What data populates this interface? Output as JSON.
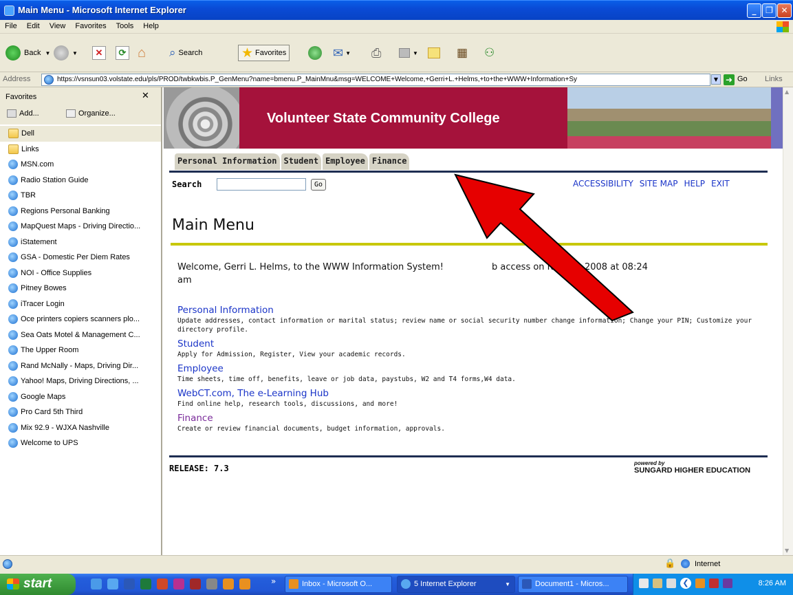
{
  "window": {
    "title": "Main Menu - Microsoft Internet Explorer"
  },
  "menubar": [
    "File",
    "Edit",
    "View",
    "Favorites",
    "Tools",
    "Help"
  ],
  "toolbar": {
    "back": "Back",
    "search": "Search",
    "favorites": "Favorites"
  },
  "address": {
    "label": "Address",
    "url": "https://vsnsun03.volstate.edu/pls/PROD/twbkwbis.P_GenMenu?name=bmenu.P_MainMnu&msg=WELCOME+Welcome,+Gerri+L.+Helms,+to+the+WWW+Information+Sy",
    "go": "Go",
    "links": "Links"
  },
  "favorites": {
    "title": "Favorites",
    "add": "Add...",
    "organize": "Organize...",
    "items": [
      "Dell",
      "Links",
      "MSN.com",
      "Radio Station Guide",
      "TBR",
      "Regions  Personal Banking",
      "MapQuest Maps - Driving Directio...",
      "iStatement",
      "GSA - Domestic Per Diem Rates",
      "NOI - Office Supplies",
      "Pitney Bowes",
      "iTracer Login",
      "Oce printers copiers scanners plo...",
      "Sea Oats Motel & Management C...",
      "The Upper Room",
      "Rand McNally - Maps, Driving Dir...",
      "Yahoo! Maps, Driving Directions, ...",
      "Google Maps",
      "Pro Card 5th Third",
      "Mix 92.9 - WJXA Nashville",
      "Welcome to UPS"
    ]
  },
  "page": {
    "college": "Volunteer State Community College",
    "tabs": [
      "Personal Information",
      "Student",
      "Employee",
      "Finance"
    ],
    "search_label": "Search",
    "go": "Go",
    "toplinks": [
      "ACCESSIBILITY",
      "SITE MAP",
      "HELP",
      "EXIT"
    ],
    "title": "Main Menu",
    "welcome_left": "Welcome, Gerri L. Helms, to the WWW Information System!",
    "welcome_right": "b access on Nov 04, 2008 at 08:24",
    "welcome_end": "am",
    "menu": [
      {
        "label": "Personal Information",
        "desc": "Update addresses, contact information or marital status; review name or social security number change information; Change your PIN; Customize your directory profile."
      },
      {
        "label": "Student",
        "desc": "Apply for Admission, Register, View your academic records."
      },
      {
        "label": "Employee",
        "desc": "Time sheets, time off, benefits, leave or job data, paystubs, W2 and T4 forms,W4 data."
      },
      {
        "label": "WebCT.com, The e-Learning Hub",
        "desc": "Find online help, research tools, discussions, and more!"
      },
      {
        "label": "Finance",
        "desc": "Create or review financial documents, budget information, approvals."
      }
    ],
    "release": "RELEASE: 7.3",
    "powered_by": "powered by",
    "sungard": "SUNGARD",
    "higher_ed": " HIGHER EDUCATION"
  },
  "status": {
    "zone": "Internet"
  },
  "taskbar": {
    "start": "start",
    "tasks": [
      "Inbox - Microsoft O...",
      "5 Internet Explorer",
      "Document1 - Micros..."
    ],
    "clock": "8:26 AM"
  },
  "colors": {
    "banner": "#a5123b",
    "link": "#1a34c8",
    "visited": "#7a2a9a",
    "arrow": "#e60000"
  }
}
